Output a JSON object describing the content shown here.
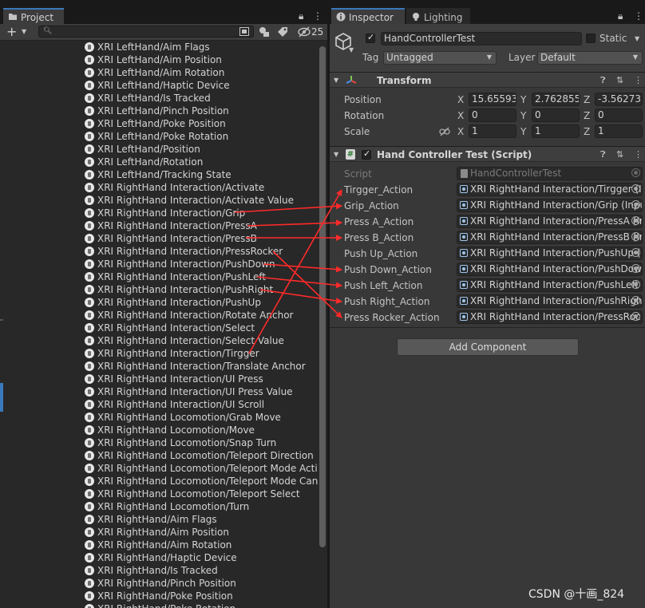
{
  "project_panel": {
    "tab_label": "Project",
    "hidden_count": "25",
    "search_placeholder": "",
    "items": [
      "XRI LeftHand/Aim Flags",
      "XRI LeftHand/Aim Position",
      "XRI LeftHand/Aim Rotation",
      "XRI LeftHand/Haptic Device",
      "XRI LeftHand/Is Tracked",
      "XRI LeftHand/Pinch Position",
      "XRI LeftHand/Poke Position",
      "XRI LeftHand/Poke Rotation",
      "XRI LeftHand/Position",
      "XRI LeftHand/Rotation",
      "XRI LeftHand/Tracking State",
      "XRI RightHand Interaction/Activate",
      "XRI RightHand Interaction/Activate Value",
      "XRI RightHand Interaction/Grip",
      "XRI RightHand Interaction/PressA",
      "XRI RightHand Interaction/PressB",
      "XRI RightHand Interaction/PressRocker",
      "XRI RightHand Interaction/PushDown",
      "XRI RightHand Interaction/PushLeft",
      "XRI RightHand Interaction/PushRight",
      "XRI RightHand Interaction/PushUp",
      "XRI RightHand Interaction/Rotate Anchor",
      "XRI RightHand Interaction/Select",
      "XRI RightHand Interaction/Select Value",
      "XRI RightHand Interaction/Tirgger",
      "XRI RightHand Interaction/Translate Anchor",
      "XRI RightHand Interaction/UI Press",
      "XRI RightHand Interaction/UI Press Value",
      "XRI RightHand Interaction/UI Scroll",
      "XRI RightHand Locomotion/Grab Move",
      "XRI RightHand Locomotion/Move",
      "XRI RightHand Locomotion/Snap Turn",
      "XRI RightHand Locomotion/Teleport Direction",
      "XRI RightHand Locomotion/Teleport Mode Activa",
      "XRI RightHand Locomotion/Teleport Mode Cance",
      "XRI RightHand Locomotion/Teleport Select",
      "XRI RightHand Locomotion/Turn",
      "XRI RightHand/Aim Flags",
      "XRI RightHand/Aim Position",
      "XRI RightHand/Aim Rotation",
      "XRI RightHand/Haptic Device",
      "XRI RightHand/Is Tracked",
      "XRI RightHand/Pinch Position",
      "XRI RightHand/Poke Position",
      "XRI RightHand/Poke Rotation"
    ]
  },
  "inspector": {
    "tab_label": "Inspector",
    "lighting_tab_label": "Lighting",
    "object_name": "HandControllerTest",
    "static_label": "Static",
    "tag_label": "Tag",
    "tag_value": "Untagged",
    "layer_label": "Layer",
    "layer_value": "Default",
    "transform": {
      "title": "Transform",
      "position_label": "Position",
      "rotation_label": "Rotation",
      "scale_label": "Scale",
      "position": {
        "x": "15.65593",
        "y": "2.762855",
        "z": "-3.56273"
      },
      "rotation": {
        "x": "0",
        "y": "0",
        "z": "0"
      },
      "scale": {
        "x": "1",
        "y": "1",
        "z": "1"
      },
      "x_label": "X",
      "y_label": "Y",
      "z_label": "Z"
    },
    "script_component": {
      "title": "Hand Controller Test (Script)",
      "script_label": "Script",
      "script_value": "HandControllerTest",
      "fields": [
        {
          "label": "Tirgger_Action",
          "value": "XRI RightHand Interaction/Tirgger (I"
        },
        {
          "label": "Grip_Action",
          "value": "XRI RightHand Interaction/Grip (Inpu"
        },
        {
          "label": "Press A_Action",
          "value": "XRI RightHand Interaction/PressA (In"
        },
        {
          "label": "Press B_Action",
          "value": "XRI RightHand Interaction/PressB (In"
        },
        {
          "label": "Push Up_Action",
          "value": "XRI RightHand Interaction/PushUp ("
        },
        {
          "label": "Push Down_Action",
          "value": "XRI RightHand Interaction/PushDow"
        },
        {
          "label": "Push Left_Action",
          "value": "XRI RightHand Interaction/PushLeft"
        },
        {
          "label": "Push Right_Action",
          "value": "XRI RightHand Interaction/PushRigh"
        },
        {
          "label": "Press Rocker_Action",
          "value": "XRI RightHand Interaction/PressRoc"
        }
      ]
    },
    "add_component_label": "Add Component"
  },
  "watermark": "CSDN @十画_824",
  "colors": {
    "arrow": "#ff2a2a",
    "tab_accent": "#3a79bb",
    "panel_bg": "#383838",
    "project_bg": "#282828"
  }
}
